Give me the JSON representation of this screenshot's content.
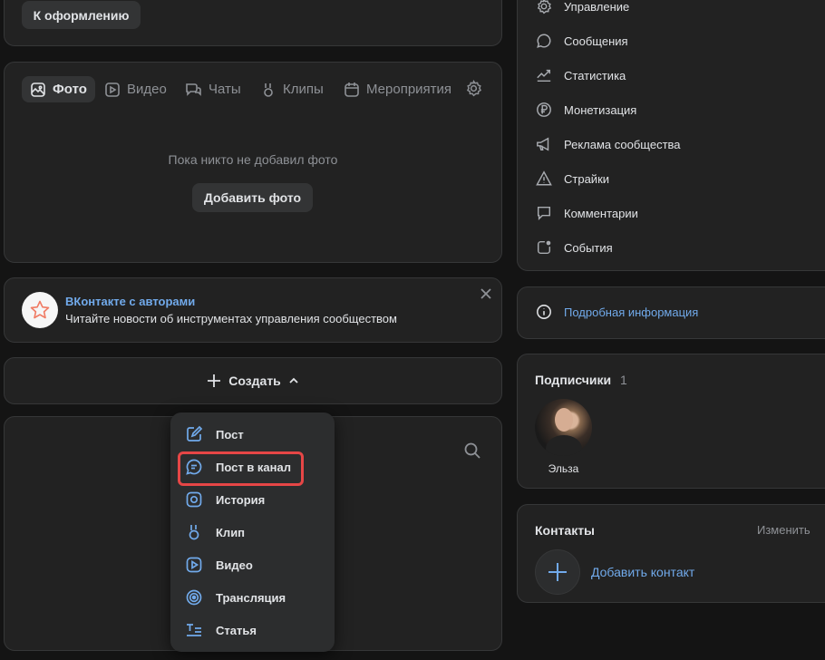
{
  "top_button": "К оформлению",
  "media": {
    "tabs": [
      {
        "label": "Фото",
        "icon": "photo-icon",
        "active": true
      },
      {
        "label": "Видео",
        "icon": "video-icon"
      },
      {
        "label": "Чаты",
        "icon": "chats-icon"
      },
      {
        "label": "Клипы",
        "icon": "clips-icon"
      },
      {
        "label": "Мероприятия",
        "icon": "calendar-icon"
      }
    ],
    "settings_icon": "gear-icon",
    "empty_text": "Пока никто не добавил фото",
    "add_button": "Добавить фото"
  },
  "promo": {
    "title": "ВКонтакте с авторами",
    "text": "Читайте новости об инструментах управления сообществом",
    "icon": "star-icon",
    "close_icon": "close-icon"
  },
  "create": {
    "label": "Создать",
    "plus_icon": "plus-icon",
    "chevron_icon": "chevron-up-icon"
  },
  "dropdown": [
    {
      "label": "Пост",
      "icon": "edit-icon"
    },
    {
      "label": "Пост в канал",
      "icon": "channel-post-icon",
      "highlighted": true
    },
    {
      "label": "История",
      "icon": "story-icon"
    },
    {
      "label": "Клип",
      "icon": "clip-icon"
    },
    {
      "label": "Видео",
      "icon": "video-icon"
    },
    {
      "label": "Трансляция",
      "icon": "broadcast-icon"
    },
    {
      "label": "Статья",
      "icon": "article-icon"
    }
  ],
  "right_menu": [
    {
      "label": "Управление",
      "icon": "gear-icon"
    },
    {
      "label": "Сообщения",
      "icon": "message-icon"
    },
    {
      "label": "Статистика",
      "icon": "statistics-icon"
    },
    {
      "label": "Монетизация",
      "icon": "ruble-icon"
    },
    {
      "label": "Реклама сообщества",
      "icon": "megaphone-icon"
    },
    {
      "label": "Страйки",
      "icon": "warning-icon"
    },
    {
      "label": "Комментарии",
      "icon": "comment-icon"
    },
    {
      "label": "События",
      "icon": "events-icon"
    }
  ],
  "info_link": "Подробная информация",
  "subscribers": {
    "title": "Подписчики",
    "count": "1",
    "members": [
      {
        "name": "Эльза"
      }
    ]
  },
  "contacts": {
    "title": "Контакты",
    "edit": "Изменить",
    "add": "Добавить контакт"
  },
  "colors": {
    "background": "#141414",
    "card": "#222222",
    "accent": "#71aaeb",
    "highlight": "#e64646"
  }
}
